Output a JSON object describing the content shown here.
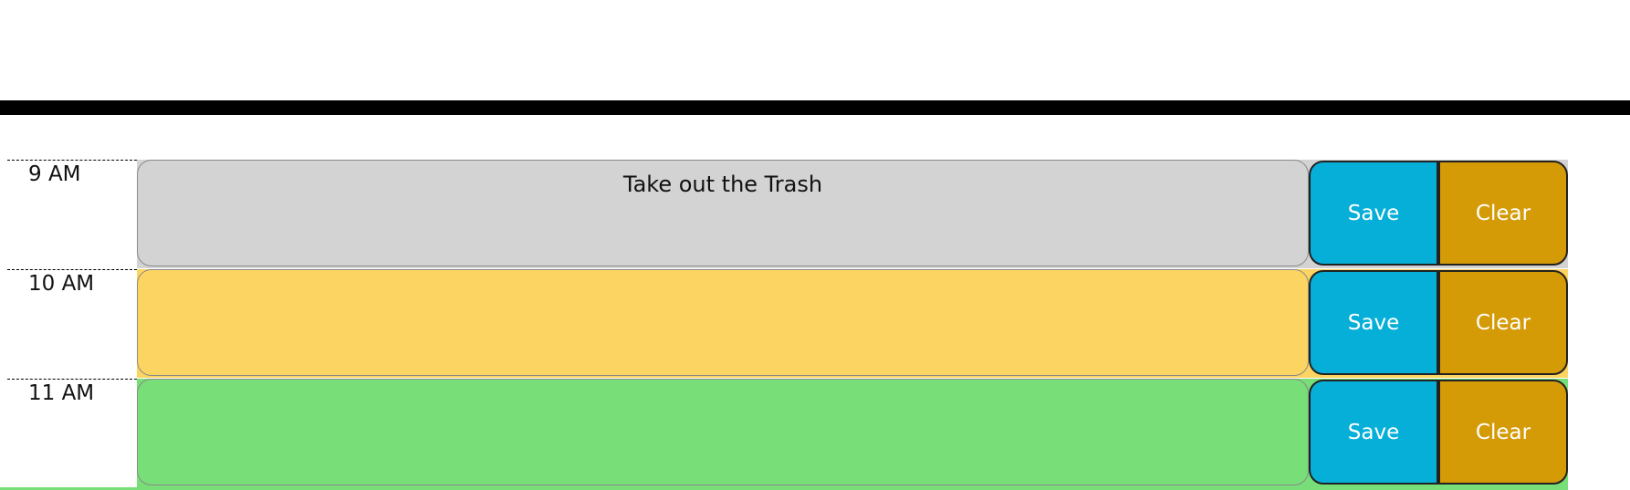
{
  "planner": {
    "rows": [
      {
        "hour": "9 AM",
        "task": "Take out the Trash",
        "state": "past",
        "save_label": "Save",
        "clear_label": "Clear"
      },
      {
        "hour": "10 AM",
        "task": "",
        "state": "present",
        "save_label": "Save",
        "clear_label": "Clear"
      },
      {
        "hour": "11 AM",
        "task": "",
        "state": "future",
        "save_label": "Save",
        "clear_label": "Clear"
      }
    ]
  },
  "colors": {
    "past": "#d3d3d3",
    "present": "#fcd462",
    "future": "#78de78",
    "save_button": "#06afd8",
    "clear_button": "#d49b07",
    "header_rule": "#000000"
  }
}
